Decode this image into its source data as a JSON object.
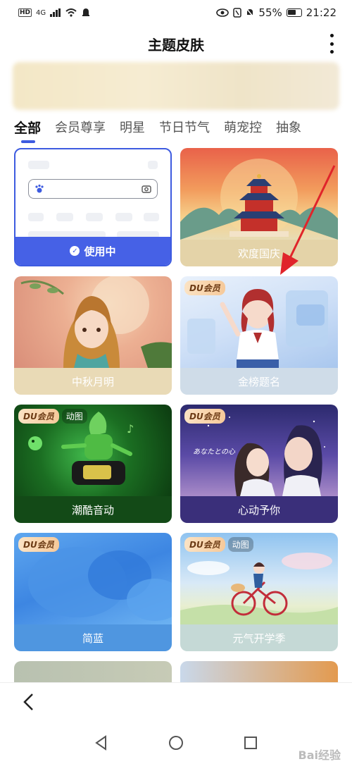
{
  "status_bar": {
    "hd": "HD",
    "net": "4G",
    "battery": "55%",
    "time": "21:22"
  },
  "header": {
    "title": "主题皮肤"
  },
  "tabs": [
    {
      "label": "全部",
      "active": true
    },
    {
      "label": "会员尊享",
      "active": false
    },
    {
      "label": "明星",
      "active": false
    },
    {
      "label": "节日节气",
      "active": false
    },
    {
      "label": "萌宠控",
      "active": false
    },
    {
      "label": "抽象",
      "active": false
    }
  ],
  "themes": [
    {
      "label": "使用中",
      "current": true
    },
    {
      "label": "欢度国庆"
    },
    {
      "label": "中秋月明"
    },
    {
      "label": "金榜题名",
      "badge": "DU会员"
    },
    {
      "label": "潮酷音动",
      "badge": "DU会员",
      "tag": "动图"
    },
    {
      "label": "心动予你",
      "badge": "DU会员",
      "artwork_text": "あなたとの心"
    },
    {
      "label": "简蓝",
      "badge": "DU会员"
    },
    {
      "label": "元气开学季",
      "badge": "DU会员",
      "tag": "动图"
    }
  ],
  "watermark": "Bai经验",
  "colors": {
    "accent": "#3d5be0",
    "current_bar": "#4661e6",
    "vip_badge": "#f6c99a"
  }
}
